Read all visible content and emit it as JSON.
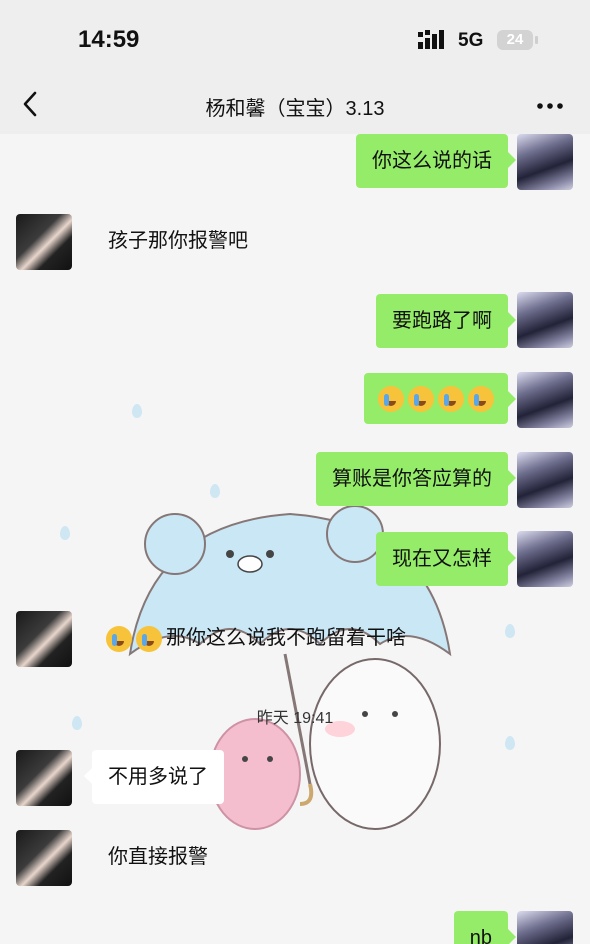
{
  "status": {
    "time": "14:59",
    "network": "5G",
    "battery": "24"
  },
  "header": {
    "title": "杨和馨（宝宝）3.13"
  },
  "messages": [
    {
      "side": "right",
      "text": "你这么说的话"
    },
    {
      "side": "left",
      "text": "孩子那你报警吧"
    },
    {
      "side": "right",
      "text": "要跑路了啊"
    },
    {
      "side": "right",
      "text": "",
      "emoji_count": 4
    },
    {
      "side": "right",
      "text": "算账是你答应算的"
    },
    {
      "side": "right",
      "text": "现在又怎样"
    },
    {
      "side": "left",
      "text": "那你这么说我不跑留着干啥",
      "emoji_count": 2
    },
    {
      "side": "left",
      "text": "不用多说了"
    },
    {
      "side": "left",
      "text": "你直接报警"
    },
    {
      "side": "right",
      "text": "nb"
    }
  ],
  "timestamp": "昨天 19:41",
  "icons": {
    "back": "chevron-left-icon",
    "more": "more-dots-icon",
    "emoji": "crying-laughing-emoji-icon"
  }
}
